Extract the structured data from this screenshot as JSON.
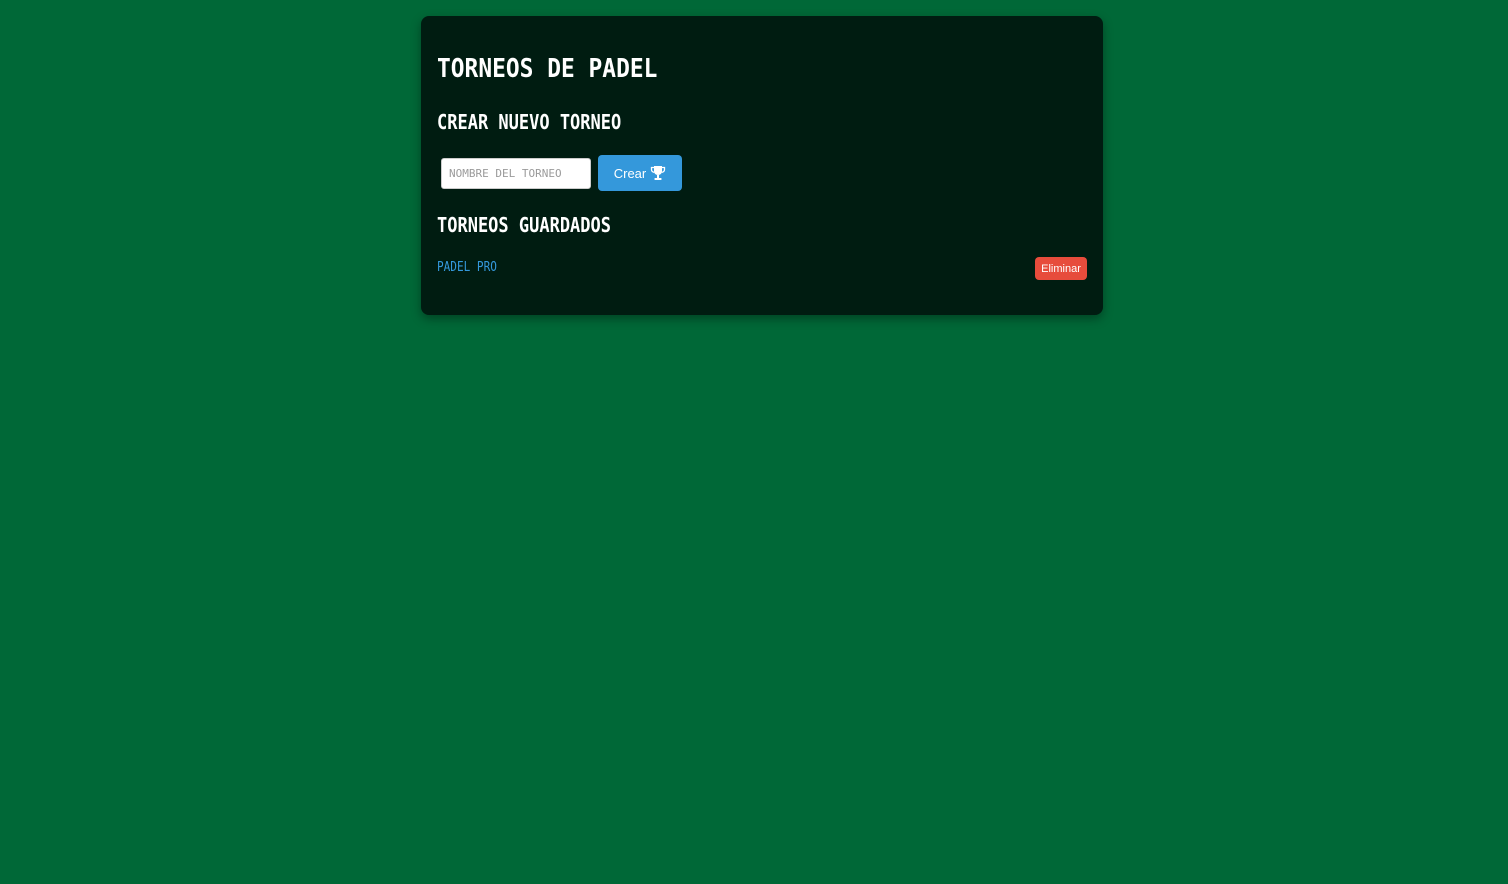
{
  "header": {
    "title": "Torneos de Padel"
  },
  "create_section": {
    "heading": "Crear nuevo torneo",
    "input_placeholder": "Nombre del torneo",
    "input_value": "",
    "create_button_label": "Crear",
    "create_button_icon": "trophy-icon"
  },
  "saved_section": {
    "heading": "Torneos guardados",
    "tournaments": [
      {
        "name": "Padel Pro",
        "delete_label": "Eliminar"
      }
    ]
  },
  "colors": {
    "page_background": "#006837",
    "card_background": "#001c11",
    "primary_button": "#3498db",
    "link": "#3498db",
    "danger_button": "#e74c3c"
  }
}
